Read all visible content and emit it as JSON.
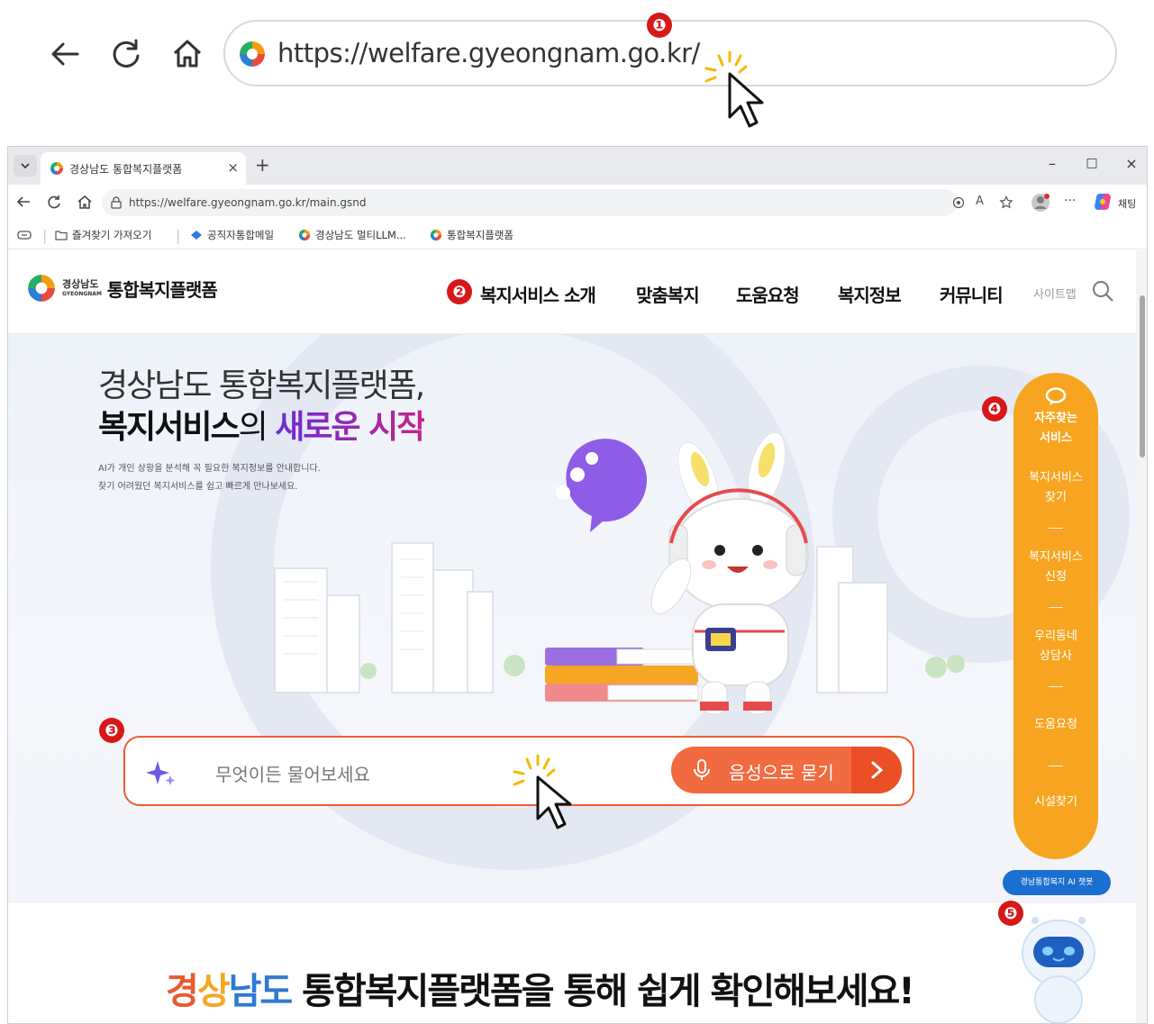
{
  "zoom": {
    "url": "https://welfare.gyeongnam.go.kr/",
    "markers": [
      "❶",
      "❷",
      "❸",
      "❹",
      "❺"
    ]
  },
  "browser": {
    "tab_title": "경상남도 통합복지플랫폼",
    "tab_close": "×",
    "new_tab": "+",
    "win_min": "–",
    "win_max": "□",
    "win_close": "×",
    "address": "https://welfare.gyeongnam.go.kr/main.gsnd",
    "chat_label": "채팅",
    "more": "···",
    "bookmarks": [
      "즐겨찾기 가져오기",
      "공직자통합메일",
      "경상남도 멀티LLM...",
      "통합복지플랫폼"
    ]
  },
  "site": {
    "logo_small": "경상남도",
    "logo_small_en": "GYEONGNAM",
    "logo_main": "통합복지플랫폼",
    "nav": [
      "복지서비스 소개",
      "맞춤복지",
      "도움요청",
      "복지정보",
      "커뮤니티"
    ],
    "sitemap": "사이트맵"
  },
  "hero": {
    "title_line1": "경상남도 통합복지플랫폼,",
    "title_line2_a": "복지서비스",
    "title_line2_b": "의 ",
    "title_line2_c": "새로운 시작",
    "desc1": "AI가 개인 상황을 분석해 꼭 필요한 복지정보를 안내합니다.",
    "desc2": "찾기 어려웠던 복지서비스를 쉽고 빠르게 만나보세요.",
    "search_placeholder": "무엇이든 물어보세요",
    "voice_button": "음성으로 묻기"
  },
  "quick_menu": {
    "title1": "자주찾는",
    "title2": "서비스",
    "items": [
      [
        "복지서비스",
        "찾기"
      ],
      [
        "복지서비스",
        "신청"
      ],
      [
        "우리동네",
        "상담사"
      ],
      [
        "도움요청",
        ""
      ],
      [
        "시설찾기",
        ""
      ]
    ]
  },
  "chatbot": {
    "badge": "경남통합복지 AI 챗봇"
  },
  "bottom": {
    "h_c1": "경",
    "h_c2": "상",
    "h_c3": "남도",
    "h_rest": " 통합복지플랫폼을 통해 쉽게 확인해보세요!"
  },
  "colors": {
    "accent_orange": "#f26a3f",
    "quick_menu": "#f7a520",
    "marker_red": "#d81818",
    "chatbot_blue": "#1b6fd1"
  },
  "icons": [
    "back-icon",
    "refresh-icon",
    "home-icon",
    "favicon-icon",
    "cursor-icon",
    "search-icon",
    "mic-icon",
    "sparkle-icon",
    "chat-bubble-icon"
  ]
}
